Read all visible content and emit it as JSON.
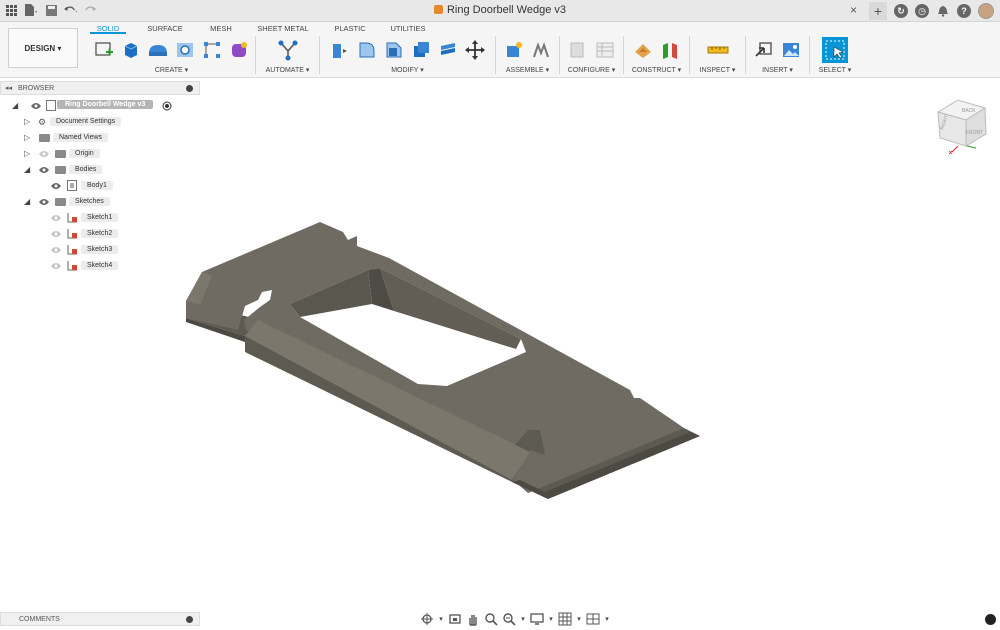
{
  "titlebar": {
    "doc_title": "Ring Doorbell Wedge v3",
    "close_glyph": "×",
    "plus_glyph": "+",
    "help_glyph": "?"
  },
  "ribbon": {
    "mode_label": "DESIGN ▾",
    "tabs": [
      "SOLID",
      "SURFACE",
      "MESH",
      "SHEET METAL",
      "PLASTIC",
      "UTILITIES"
    ],
    "active_tab": "SOLID",
    "groups": [
      "CREATE ▾",
      "AUTOMATE ▾",
      "MODIFY ▾",
      "ASSEMBLE ▾",
      "CONFIGURE ▾",
      "CONSTRUCT ▾",
      "INSPECT ▾",
      "INSERT ▾",
      "SELECT ▾"
    ]
  },
  "browser": {
    "title": "BROWSER",
    "collapse_glyph": "◂◂",
    "root": "Ring Doorbell Wedge v3",
    "items": [
      {
        "label": "Document Settings",
        "icon": "gear-icon"
      },
      {
        "label": "Named Views",
        "icon": "folder-icon"
      },
      {
        "label": "Origin",
        "icon": "folder-icon"
      },
      {
        "label": "Bodies",
        "icon": "folder-icon"
      },
      {
        "label": "Body1",
        "icon": "body-icon"
      },
      {
        "label": "Sketches",
        "icon": "folder-icon"
      },
      {
        "label": "Sketch1",
        "icon": "sketch-icon"
      },
      {
        "label": "Sketch2",
        "icon": "sketch-icon"
      },
      {
        "label": "Sketch3",
        "icon": "sketch-icon"
      },
      {
        "label": "Sketch4",
        "icon": "sketch-icon"
      }
    ]
  },
  "comments": {
    "title": "COMMENTS"
  },
  "viewcube": {
    "front": "FRONT",
    "right": "RIGHT",
    "back": "BACK"
  },
  "colors": {
    "accent": "#0696d7",
    "body": "#6f6b62"
  }
}
